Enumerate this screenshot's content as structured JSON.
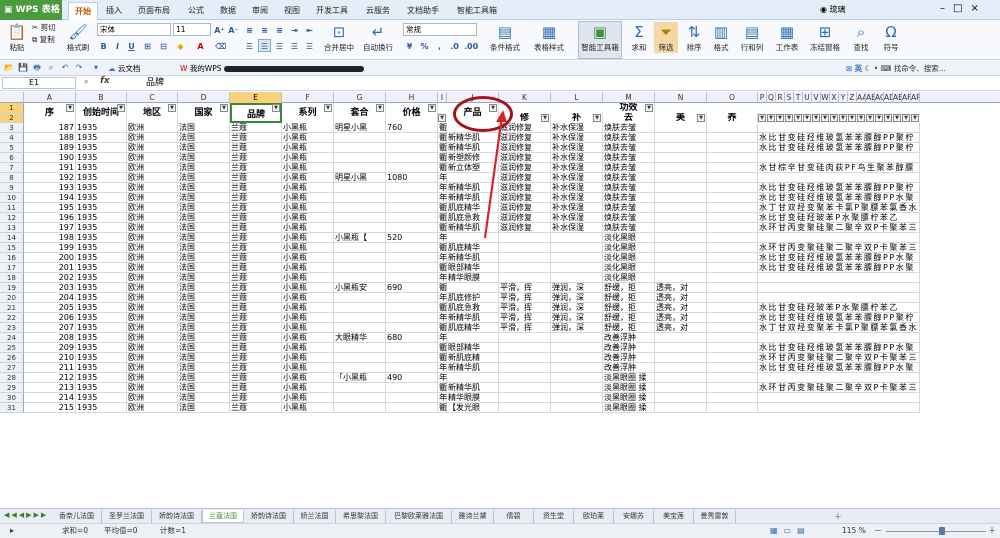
{
  "app": {
    "name": "WPS 表格",
    "user": "琉璃"
  },
  "menu_tabs": [
    "开始",
    "插入",
    "页面布局",
    "公式",
    "数据",
    "审阅",
    "视图",
    "开发工具",
    "云服务",
    "文档助手",
    "智能工具箱"
  ],
  "ribbon": {
    "paste": "粘贴",
    "cut": "剪切",
    "copy": "复制",
    "format_painter": "格式刷",
    "font_name": "宋体",
    "font_size": "11",
    "merge_center": "合并居中",
    "wrap_text": "自动换行",
    "number_format": "常规",
    "cond_format": "条件格式",
    "table_style": "表格样式",
    "smart_toolbox": "智能工具箱",
    "sum": "求和",
    "filter": "筛选",
    "sort": "排序",
    "format": "格式",
    "row_col": "行和列",
    "worksheet": "工作表",
    "freeze": "冻结窗格",
    "find": "查找",
    "symbol": "符号",
    "search_hint": "找命令、搜索..."
  },
  "qabar": {
    "cloud_docs": "云文档",
    "my_wps": "我的WPS",
    "input_mode": "英"
  },
  "formula_bar": {
    "name_box": "E1",
    "fx": "fx",
    "content": "品牌"
  },
  "columns": [
    {
      "l": "A",
      "w": 52
    },
    {
      "l": "B",
      "w": 51
    },
    {
      "l": "C",
      "w": 51
    },
    {
      "l": "D",
      "w": 52
    },
    {
      "l": "E",
      "w": 52
    },
    {
      "l": "F",
      "w": 52
    },
    {
      "l": "G",
      "w": 52
    },
    {
      "l": "H",
      "w": 52
    },
    {
      "l": "I",
      "w": 9
    },
    {
      "l": "J",
      "w": 52
    },
    {
      "l": "K",
      "w": 52
    },
    {
      "l": "L",
      "w": 52
    },
    {
      "l": "M",
      "w": 52
    },
    {
      "l": "N",
      "w": 52
    },
    {
      "l": "O",
      "w": 51
    },
    {
      "l": "P",
      "w": 9
    },
    {
      "l": "Q",
      "w": 9
    },
    {
      "l": "R",
      "w": 9
    },
    {
      "l": "S",
      "w": 9
    },
    {
      "l": "T",
      "w": 9
    },
    {
      "l": "U",
      "w": 9
    },
    {
      "l": "V",
      "w": 9
    },
    {
      "l": "W",
      "w": 9
    },
    {
      "l": "X",
      "w": 9
    },
    {
      "l": "Y",
      "w": 9
    },
    {
      "l": "Z",
      "w": 9
    },
    {
      "l": "AA",
      "w": 9
    },
    {
      "l": "AB",
      "w": 9
    },
    {
      "l": "AC",
      "w": 9
    },
    {
      "l": "AD",
      "w": 9
    },
    {
      "l": "AE",
      "w": 9
    },
    {
      "l": "AF",
      "w": 9
    },
    {
      "l": "AP",
      "w": 9
    }
  ],
  "header_row": {
    "A": "序",
    "B": "创始时间",
    "C": "地区",
    "D": "国家",
    "E": "品牌",
    "F": "系列",
    "G": "套合",
    "H": "价格",
    "J": "产品",
    "K": "修",
    "L": "补",
    "M1": "功效",
    "M2": "去",
    "N": "美",
    "O": "养"
  },
  "rows": [
    {
      "r": 3,
      "A": "187",
      "B": "1935",
      "C": "欧洲",
      "D": "法国",
      "E": "兰蔻",
      "F": "小黑瓶",
      "G": "明星小黑",
      "H": "760",
      "I": "衢",
      "K": "滋润修复",
      "L": "补水保湿",
      "M": "焕肤去皱",
      "P": ""
    },
    {
      "r": 4,
      "A": "188",
      "B": "1935",
      "C": "欧洲",
      "D": "法国",
      "E": "兰蔻",
      "F": "小黑瓶",
      "I": "衢",
      "J": "新精华肌",
      "K": "滋润修复",
      "L": "补水保湿",
      "M": "焕肤去皱",
      "P": "水 比 甘 变 硅 羟 维 玻 氢 苯 苯 膘 醇 P  P  聚 柠"
    },
    {
      "r": 5,
      "A": "189",
      "B": "1935",
      "C": "欧洲",
      "D": "法国",
      "E": "兰蔻",
      "F": "小黑瓶",
      "I": "衢",
      "J": "新精华肌",
      "K": "滋润修复",
      "L": "补水保湿",
      "M": "焕肤去皱",
      "P": "水 比 甘 变 硅 羟 维 玻 氢 苯 苯 膘 醇 P  P  聚 柠"
    },
    {
      "r": 6,
      "A": "190",
      "B": "1935",
      "C": "欧洲",
      "D": "法国",
      "E": "兰蔻",
      "F": "小黑瓶",
      "I": "衢",
      "J": "新塑颜修",
      "K": "滋润修复",
      "L": "补水保湿",
      "M": "焕肤去皱",
      "P": ""
    },
    {
      "r": 7,
      "A": "191",
      "B": "1935",
      "C": "欧洲",
      "D": "法国",
      "E": "兰蔻",
      "F": "小黑瓶",
      "I": "衢",
      "J": "新立体塑",
      "K": "滋润修复",
      "L": "补水保湿",
      "M": "焕肤去皱",
      "P": "水 甘 棕 辛 甘 变 硅 肉 荻 P  F  鸟 生 聚 苯 醇 膘"
    },
    {
      "r": 8,
      "A": "192",
      "B": "1935",
      "C": "欧洲",
      "D": "法国",
      "E": "兰蔻",
      "F": "小黑瓶",
      "G": "明星小黑",
      "H": "1080",
      "I": "年",
      "K": "滋润修复",
      "L": "补水保湿",
      "M": "焕肤去皱",
      "P": ""
    },
    {
      "r": 9,
      "A": "193",
      "B": "1935",
      "C": "欧洲",
      "D": "法国",
      "E": "兰蔻",
      "F": "小黑瓶",
      "I": "年",
      "J": "新精华肌",
      "K": "滋润修复",
      "L": "补水保湿",
      "M": "焕肤去皱",
      "P": "水 比 甘 变 硅 羟 维 玻 氢 苯 苯 膘 醇 P  P  聚 柠"
    },
    {
      "r": 10,
      "A": "194",
      "B": "1935",
      "C": "欧洲",
      "D": "法国",
      "E": "兰蔻",
      "F": "小黑瓶",
      "I": "年",
      "J": "新精华肌",
      "K": "滋润修复",
      "L": "补水保湿",
      "M": "焕肤去皱",
      "P": "水 比 甘 变 硅 羟 维 玻 氢 苯 苯 膘 醇 P  P  水 聚"
    },
    {
      "r": 11,
      "A": "195",
      "B": "1935",
      "C": "欧洲",
      "D": "法国",
      "E": "兰蔻",
      "F": "小黑瓶",
      "I": "衢",
      "J": "肌底精华",
      "K": "滋润修复",
      "L": "补水保湿",
      "M": "焕肤去皱",
      "P": "水 丁 甘 双 羟 变 聚 苯 卡 氯 P  聚 膘 苯 氯 香 水"
    },
    {
      "r": 12,
      "A": "196",
      "B": "1935",
      "C": "欧洲",
      "D": "法国",
      "E": "兰蔻",
      "F": "小黑瓶",
      "I": "衢",
      "J": "肌底急救",
      "K": "滋润修复",
      "L": "补水保湿",
      "M": "焕肤去皱",
      "P": "水 比 甘 变 硅 羟 玻 苯 P  水 聚 膘 柠 苯 乙"
    },
    {
      "r": 13,
      "A": "197",
      "B": "1935",
      "C": "欧洲",
      "D": "法国",
      "E": "兰蔻",
      "F": "小黑瓶",
      "I": "衢",
      "J": "新精华肌",
      "K": "滋润修复",
      "L": "补水保湿",
      "M": "焕肤去皱",
      "P": "水 环 甘 丙 变 聚 硅 聚 二 聚 辛 双 P  卡 聚 苯 三"
    },
    {
      "r": 14,
      "A": "198",
      "B": "1935",
      "C": "欧洲",
      "D": "法国",
      "E": "兰蔻",
      "F": "小黑瓶",
      "G": "小黑瓶【",
      "H": "520",
      "I": "年",
      "M": "淡化黑眼",
      "P": ""
    },
    {
      "r": 15,
      "A": "199",
      "B": "1935",
      "C": "欧洲",
      "D": "法国",
      "E": "兰蔻",
      "F": "小黑瓶",
      "I": "衢",
      "J": "肌底精华",
      "M": "淡化黑眼",
      "P": "水 环 甘 丙 变 聚 硅 聚 二 聚 辛 双 P  卡 聚 苯 三"
    },
    {
      "r": 16,
      "A": "200",
      "B": "1935",
      "C": "欧洲",
      "D": "法国",
      "E": "兰蔻",
      "F": "小黑瓶",
      "I": "年",
      "J": "新精华肌",
      "M": "淡化黑眼",
      "P": "水 比 甘 变 硅 羟 维 玻 氢 苯 苯 膘 醇 P  P  水 聚"
    },
    {
      "r": 17,
      "A": "201",
      "B": "1935",
      "C": "欧洲",
      "D": "法国",
      "E": "兰蔻",
      "F": "小黑瓶",
      "I": "衢",
      "J": "眼部精华",
      "M": "淡化黑眼",
      "P": "水 比 甘 变 硅 羟 维 玻 氢 苯 苯 膘 醇 P  P  水 聚"
    },
    {
      "r": 18,
      "A": "202",
      "B": "1935",
      "C": "欧洲",
      "D": "法国",
      "E": "兰蔻",
      "F": "小黑瓶",
      "I": "年",
      "J": "精华眼膜",
      "M": "淡化黑眼",
      "P": ""
    },
    {
      "r": 19,
      "A": "203",
      "B": "1935",
      "C": "欧洲",
      "D": "法国",
      "E": "兰蔻",
      "F": "小黑瓶",
      "G": "小黑瓶安",
      "H": "690",
      "I": "衢",
      "K": "平滑，挥",
      "L": "弹润，深",
      "M": "舒缓，拒",
      "N": "透亮，对",
      "P": ""
    },
    {
      "r": 20,
      "A": "204",
      "B": "1935",
      "C": "欧洲",
      "D": "法国",
      "E": "兰蔻",
      "F": "小黑瓶",
      "I": "年",
      "J": "肌底修护",
      "K": "平滑，挥",
      "L": "弹润，深",
      "M": "舒缓，拒",
      "N": "透亮，对",
      "P": ""
    },
    {
      "r": 21,
      "A": "205",
      "B": "1935",
      "C": "欧洲",
      "D": "法国",
      "E": "兰蔻",
      "F": "小黑瓶",
      "I": "衢",
      "J": "肌底急救",
      "K": "平滑，挥",
      "L": "弹润，深",
      "M": "舒缓，拒",
      "N": "透亮，对",
      "P": "水 比 甘 变 硅 羟 玻 苯 P  水 聚 膘 柠 苯 乙"
    },
    {
      "r": 22,
      "A": "206",
      "B": "1935",
      "C": "欧洲",
      "D": "法国",
      "E": "兰蔻",
      "F": "小黑瓶",
      "I": "年",
      "J": "新精华肌",
      "K": "平滑，挥",
      "L": "弹润，深",
      "M": "舒缓，拒",
      "N": "透亮，对",
      "P": "水 比 甘 变 硅 羟 维 玻 氢 苯 苯 膘 醇 P  P  聚 柠"
    },
    {
      "r": 23,
      "A": "207",
      "B": "1935",
      "C": "欧洲",
      "D": "法国",
      "E": "兰蔻",
      "F": "小黑瓶",
      "I": "衢",
      "J": "肌底精华",
      "K": "平滑，挥",
      "L": "弹润，深",
      "M": "舒缓，拒",
      "N": "透亮，对",
      "P": "水 丁 甘 双 羟 变 聚 苯 卡 氯 P  聚 膘 苯 氯 香 水"
    },
    {
      "r": 24,
      "A": "208",
      "B": "1935",
      "C": "欧洲",
      "D": "法国",
      "E": "兰蔻",
      "F": "小黑瓶",
      "G": "大眼精华",
      "H": "680",
      "I": "年",
      "M": "改善浮肿",
      "P": ""
    },
    {
      "r": 25,
      "A": "209",
      "B": "1935",
      "C": "欧洲",
      "D": "法国",
      "E": "兰蔻",
      "F": "小黑瓶",
      "I": "衢",
      "J": "眼部精华",
      "M": "改善浮肿",
      "P": "水 比 甘 变 硅 羟 维 玻 氢 苯 苯 膘 醇 P  P  水 聚"
    },
    {
      "r": 26,
      "A": "210",
      "B": "1935",
      "C": "欧洲",
      "D": "法国",
      "E": "兰蔻",
      "F": "小黑瓶",
      "I": "衢",
      "J": "新肌底精",
      "M": "改善浮肿",
      "P": "水 环 甘 丙 变 聚 硅 聚 二 聚 辛 双 P  卡 聚 苯 三"
    },
    {
      "r": 27,
      "A": "211",
      "B": "1935",
      "C": "欧洲",
      "D": "法国",
      "E": "兰蔻",
      "F": "小黑瓶",
      "I": "年",
      "J": "新精华肌",
      "M": "改善浮肿",
      "P": "水 比 甘 变 硅 羟 维 玻 氢 苯 苯 膘 醇 P  P  水 聚"
    },
    {
      "r": 28,
      "A": "212",
      "B": "1935",
      "C": "欧洲",
      "D": "法国",
      "E": "兰蔻",
      "F": "小黑瓶",
      "G": "「小黑瓶",
      "H": "490",
      "I": "年",
      "M": "淡黑眼圈 揉",
      "P": ""
    },
    {
      "r": 29,
      "A": "213",
      "B": "1935",
      "C": "欧洲",
      "D": "法国",
      "E": "兰蔻",
      "F": "小黑瓶",
      "I": "衢",
      "J": "新精华肌",
      "M": "淡黑眼圈 揉",
      "P": "水 环 甘 丙 变 聚 硅 聚 二 聚 辛 双 P  卡 聚 苯 三"
    },
    {
      "r": 30,
      "A": "214",
      "B": "1935",
      "C": "欧洲",
      "D": "法国",
      "E": "兰蔻",
      "F": "小黑瓶",
      "I": "年",
      "J": "精华眼膜",
      "M": "淡黑眼圈 揉",
      "P": ""
    },
    {
      "r": 31,
      "A": "215",
      "B": "1935",
      "C": "欧洲",
      "D": "法国",
      "E": "兰蔻",
      "F": "小黑瓶",
      "I": "衢",
      "J": "【发光眼",
      "M": "淡黑眼圈 揉",
      "P": ""
    }
  ],
  "sheet_tabs": [
    "香奈儿法国",
    "圣罗兰法国",
    "娇韵诗法国",
    "兰蔻法国",
    "娇韵诗法国",
    "娇兰法国",
    "希思黎法国",
    "巴黎欧莱雅法国",
    "雅诗兰黛",
    "倩碧",
    "资生堂",
    "欧珀莱",
    "安娜苏",
    "美宝莲",
    "曼秀雷敦"
  ],
  "active_sheet": 3,
  "status": {
    "sum": "求和=0",
    "avg": "平均值=0",
    "count": "计数=1",
    "zoom": "115 %"
  }
}
